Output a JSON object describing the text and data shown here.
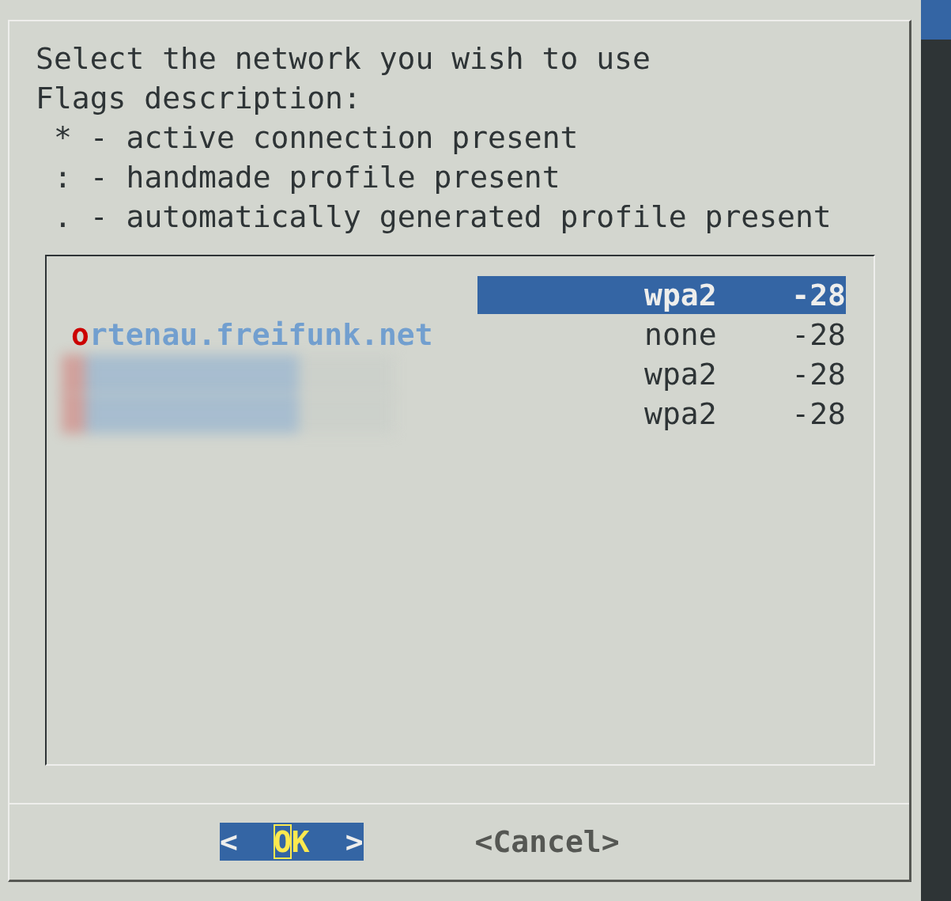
{
  "dialog": {
    "prompt": "Select the network you wish to use",
    "legend_title": "Flags description:",
    "legend": [
      "* - active connection present",
      ": - handmade profile present",
      ". - automatically generated profile present"
    ]
  },
  "networks": [
    {
      "kind": "hidden",
      "security": "wpa2",
      "signal": "-28",
      "selected": true
    },
    {
      "kind": "named",
      "ssid": "ortenau.freifunk.net",
      "security": "none",
      "signal": "-28",
      "selected": false
    },
    {
      "kind": "redacted",
      "security": "wpa2",
      "signal": "-28",
      "selected": false
    },
    {
      "kind": "redacted",
      "security": "wpa2",
      "signal": "-28",
      "selected": false
    }
  ],
  "buttons": [
    {
      "left": "<",
      "label": "OK",
      "right": ">",
      "selected": true
    },
    {
      "left": "<",
      "label": "Cancel",
      "right": ">",
      "selected": false
    }
  ]
}
